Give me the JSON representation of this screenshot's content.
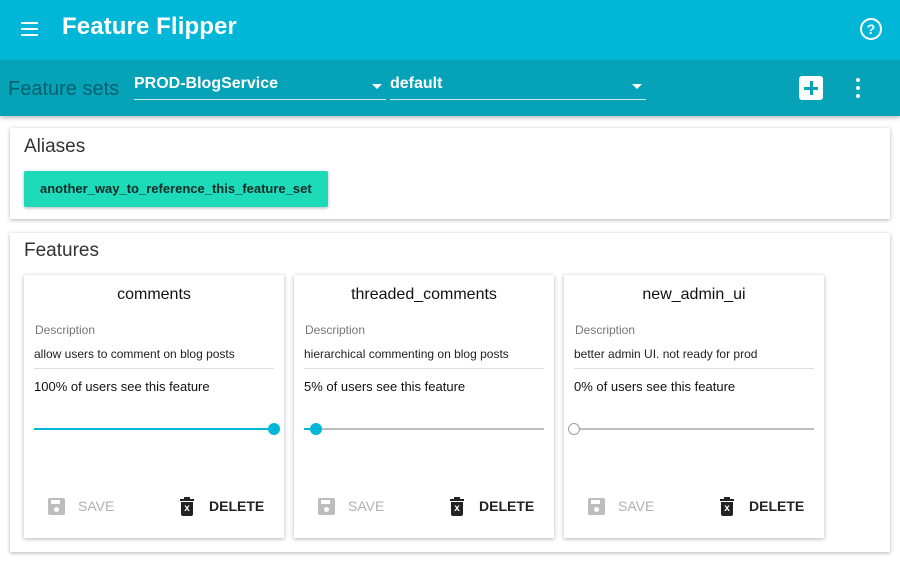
{
  "app": {
    "title": "Feature Flipper",
    "menu_icon": "hamburger-menu-icon",
    "help_icon": "help-circle-icon",
    "help_glyph": "?"
  },
  "toolbar": {
    "feature_sets_label": "Feature sets",
    "feature_set_select": {
      "value": "PROD-BlogService"
    },
    "variant_select": {
      "value": "default"
    },
    "add_icon": "add-box-icon",
    "more_icon": "more-vert-icon"
  },
  "aliases": {
    "title": "Aliases",
    "items": [
      "another_way_to_reference_this_feature_set"
    ]
  },
  "features": {
    "title": "Features",
    "description_label": "Description",
    "save_label": "SAVE",
    "delete_label": "DELETE",
    "items": [
      {
        "name": "comments",
        "description": "allow users to comment on blog posts",
        "percent_text": "100% of users see this feature",
        "percent": 100
      },
      {
        "name": "threaded_comments",
        "description": "hierarchical commenting on blog posts",
        "percent_text": "5% of users see this feature",
        "percent": 5
      },
      {
        "name": "new_admin_ui",
        "description": "better admin UI. not ready for prod",
        "percent_text": "0% of users see this feature",
        "percent": 0
      }
    ]
  },
  "colors": {
    "app_bar": "#01b6d6",
    "toolbar": "#06a2b8",
    "alias_chip": "#1ddab8",
    "slider_accent": "#01b6d6"
  }
}
